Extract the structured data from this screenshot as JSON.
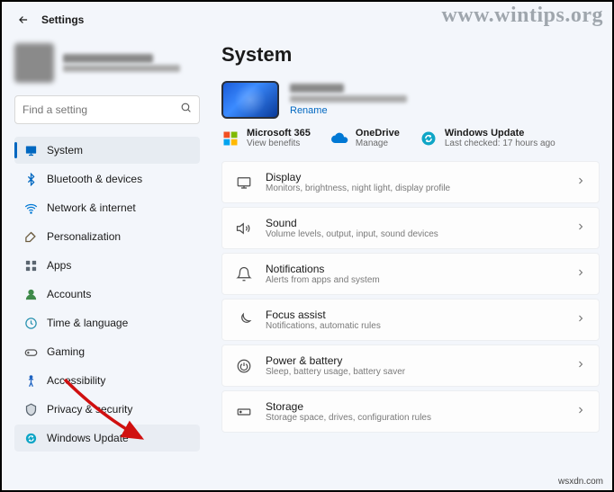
{
  "watermark": "www.wintips.org",
  "watermark2": "wsxdn.com",
  "header": {
    "title": "Settings"
  },
  "search": {
    "placeholder": "Find a setting"
  },
  "sidebar": {
    "items": [
      {
        "label": "System",
        "active": true
      },
      {
        "label": "Bluetooth & devices"
      },
      {
        "label": "Network & internet"
      },
      {
        "label": "Personalization"
      },
      {
        "label": "Apps"
      },
      {
        "label": "Accounts"
      },
      {
        "label": "Time & language"
      },
      {
        "label": "Gaming"
      },
      {
        "label": "Accessibility"
      },
      {
        "label": "Privacy & security"
      },
      {
        "label": "Windows Update",
        "highlight": true
      }
    ]
  },
  "page": {
    "title": "System",
    "device": {
      "rename": "Rename"
    },
    "tiles": [
      {
        "title": "Microsoft 365",
        "sub": "View benefits"
      },
      {
        "title": "OneDrive",
        "sub": "Manage"
      },
      {
        "title": "Windows Update",
        "sub": "Last checked: 17 hours ago"
      }
    ],
    "cards": [
      {
        "title": "Display",
        "sub": "Monitors, brightness, night light, display profile"
      },
      {
        "title": "Sound",
        "sub": "Volume levels, output, input, sound devices"
      },
      {
        "title": "Notifications",
        "sub": "Alerts from apps and system"
      },
      {
        "title": "Focus assist",
        "sub": "Notifications, automatic rules"
      },
      {
        "title": "Power & battery",
        "sub": "Sleep, battery usage, battery saver"
      },
      {
        "title": "Storage",
        "sub": "Storage space, drives, configuration rules"
      }
    ]
  }
}
